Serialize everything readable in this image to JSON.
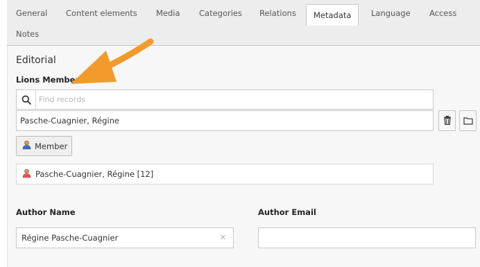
{
  "tabs": [
    {
      "label": "General",
      "active": false
    },
    {
      "label": "Content elements",
      "active": false
    },
    {
      "label": "Media",
      "active": false
    },
    {
      "label": "Categories",
      "active": false
    },
    {
      "label": "Relations",
      "active": false
    },
    {
      "label": "Metadata",
      "active": true
    },
    {
      "label": "Language",
      "active": false
    },
    {
      "label": "Access",
      "active": false
    },
    {
      "label": "Notes",
      "active": false
    }
  ],
  "section": {
    "title": "Editorial"
  },
  "lions_member": {
    "label": "Lions Member:",
    "search_placeholder": "Find records",
    "selected_value": "Pasche-Cuagnier, Régine",
    "member_button_label": "Member",
    "record_label": "Pasche-Cuagnier, Régine [12]"
  },
  "author_name": {
    "label": "Author Name",
    "value": "Régine Pasche-Cuagnier"
  },
  "author_email": {
    "label": "Author Email",
    "value": ""
  },
  "icons": {
    "search": "search-icon",
    "delete": "trash-icon",
    "browse": "folder-icon",
    "member": "user-icon",
    "clear": "clear-icon",
    "annotation": "arrow-annotation"
  },
  "colors": {
    "annotation_arrow": "#f39a2c",
    "user_icon": "#e0565b"
  }
}
